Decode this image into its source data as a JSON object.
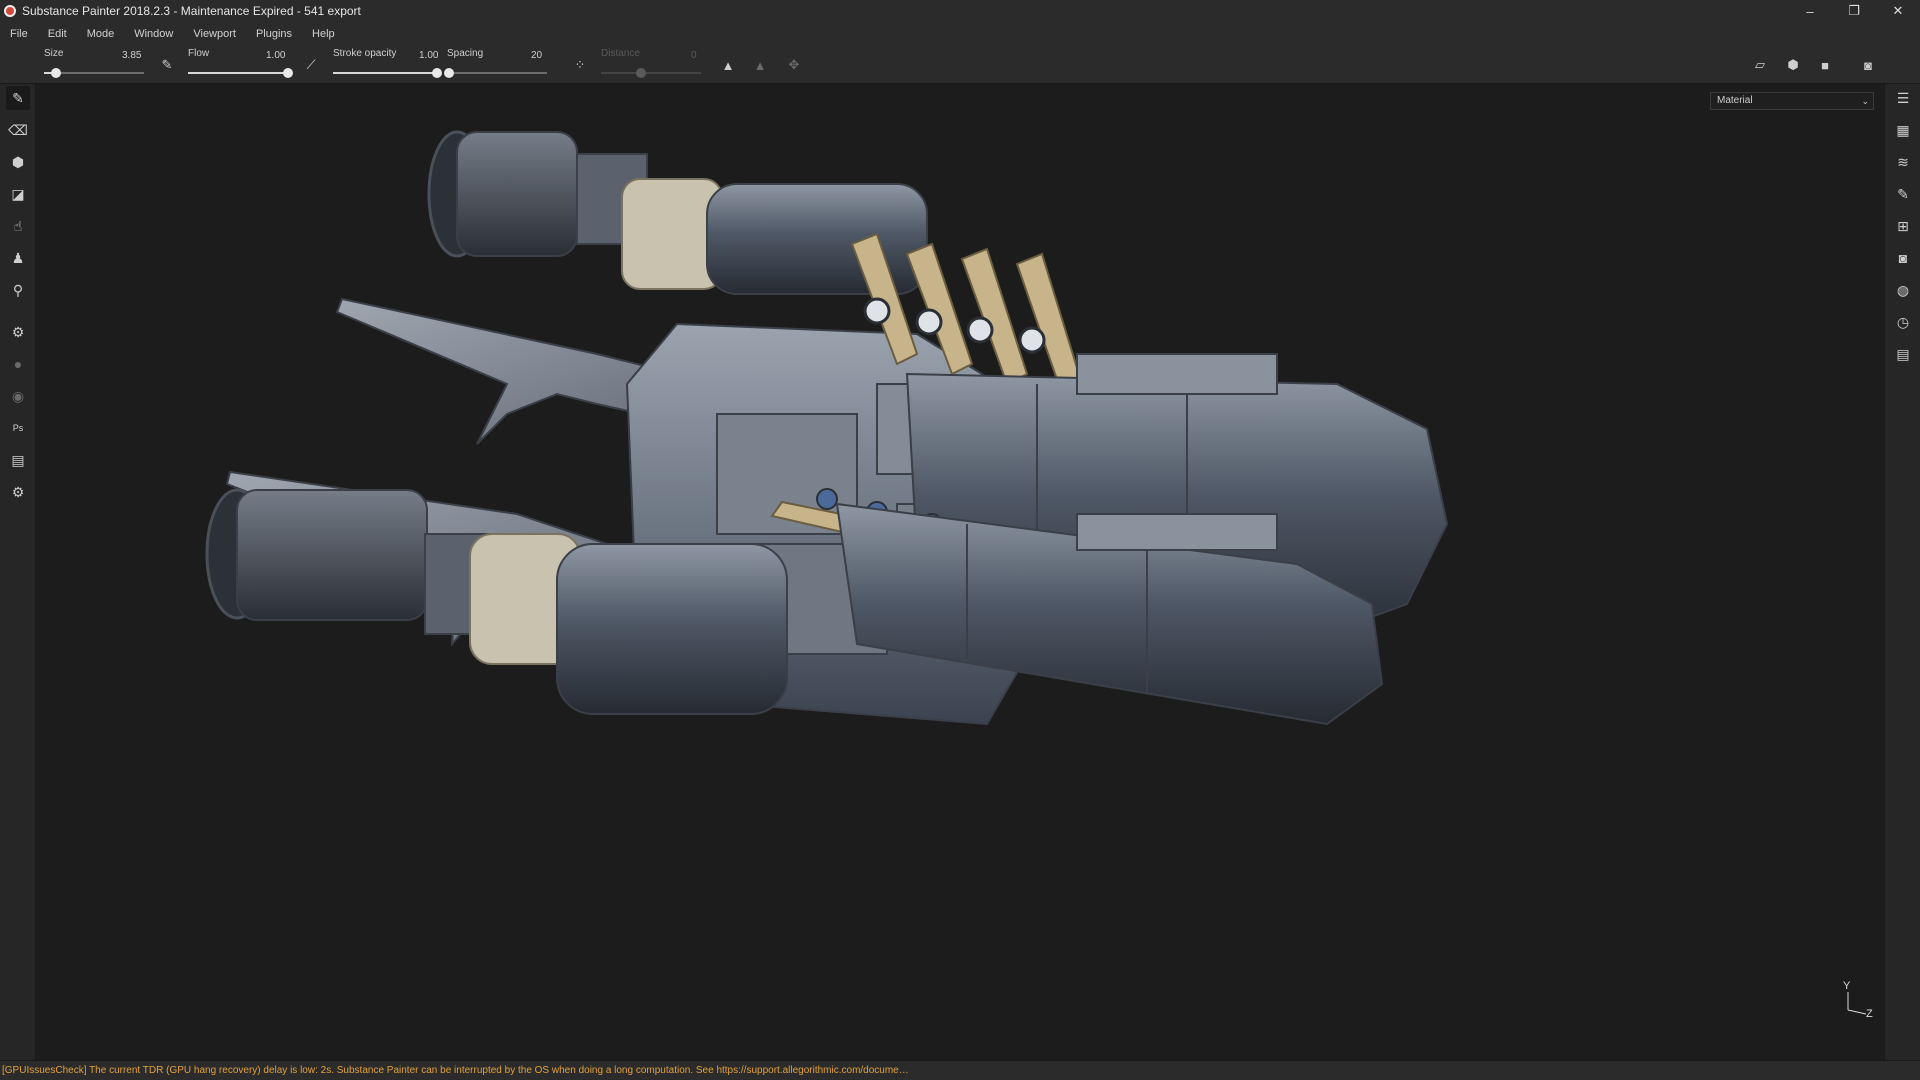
{
  "window": {
    "title": "Substance Painter 2018.2.3 - Maintenance Expired - 541 export",
    "minimize": "–",
    "restore": "❐",
    "close": "✕"
  },
  "menu": [
    "File",
    "Edit",
    "Mode",
    "Window",
    "Viewport",
    "Plugins",
    "Help"
  ],
  "toolbar": {
    "size": {
      "label": "Size",
      "value": "3.85",
      "level": 0.12
    },
    "flow": {
      "label": "Flow",
      "value": "1.00",
      "level": 1.0
    },
    "stroke_opacity": {
      "label": "Stroke opacity",
      "value": "1.00",
      "level": 1.0
    },
    "spacing": {
      "label": "Spacing",
      "value": "20",
      "level": 0.02
    },
    "distance": {
      "label": "Distance",
      "value": "0",
      "level": 0.4
    }
  },
  "viewport": {
    "mode_select": "Material",
    "gizmo_y": "Y",
    "gizmo_z": "Z"
  },
  "left_tools": [
    "paint-brush-icon",
    "eraser-icon",
    "projection-icon",
    "polygon-fill-icon",
    "smudge-icon",
    "clone-icon",
    "color-picker-icon",
    "bake-icon",
    "render-icon",
    "iray-icon",
    "photoshop-export-icon",
    "export-textures-icon",
    "settings-icon"
  ],
  "right_tools": [
    "layers-panel-icon",
    "texture-set-icon",
    "layer-stack-icon",
    "properties-icon",
    "shelf-icon",
    "display-settings-icon",
    "shader-settings-icon",
    "history-icon",
    "log-icon"
  ],
  "status": {
    "message": "[GPUIssuesCheck] The current TDR (GPU hang recovery) delay is low: 2s. Substance Painter can be interrupted by the OS when doing a long computation. See https://support.allegorithmic.com/docume…"
  },
  "colors": {
    "background": "#1c1c1c",
    "panel": "#2b2b2b",
    "status_warning": "#e3a13a",
    "hull_metal": "#7d8794",
    "tan_accent": "#c8b48a"
  }
}
